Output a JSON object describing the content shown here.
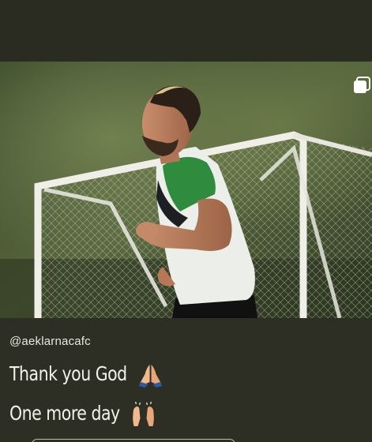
{
  "story": {
    "image_alt_subject": "",
    "carousel_icon": "multiple-images-icon",
    "praying_emoji_icon": "praying-hands-emoji-icon",
    "raised_hands_emoji_icon": "raised-hands-emoji-icon"
  },
  "caption": {
    "handle": "@aeklarnacafc",
    "line1": "Thank you God",
    "line2": "One more day"
  },
  "colors": {
    "background": "#2b2c22",
    "text": "#f2f2ec",
    "shirt_green": "#2f8b3e"
  }
}
